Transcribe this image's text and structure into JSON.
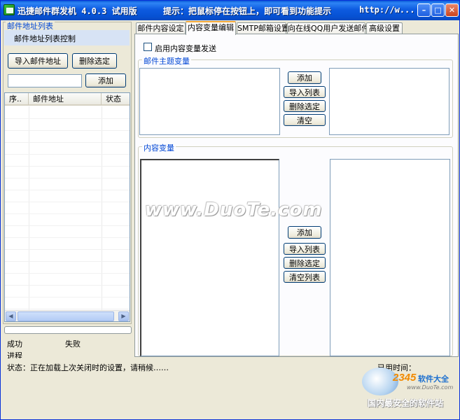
{
  "window": {
    "title": "迅捷邮件群发机 4.0.3 试用版",
    "tip": "提示：把鼠标停在按钮上，即可看到功能提示",
    "url": "http://w..."
  },
  "left": {
    "group_title": "邮件地址列表",
    "list_control_label": "邮件地址列表控制",
    "import_button": "导入邮件地址",
    "delete_button": "删除选定",
    "add_input_value": "",
    "add_button": "添加",
    "table": {
      "columns": [
        "序..",
        "邮件地址",
        "状态"
      ],
      "rows": []
    },
    "success_label": "成功",
    "fail_label": "失败",
    "progress_label": "进程",
    "progress": 0
  },
  "tabs": [
    {
      "label": "邮件内容设定",
      "active": false
    },
    {
      "label": "内容变量编辑",
      "active": true
    },
    {
      "label": "SMTP邮箱设置",
      "active": false
    },
    {
      "label": "向在线QQ用户发送邮件",
      "active": false
    },
    {
      "label": "高级设置",
      "active": false
    }
  ],
  "content": {
    "enable_checkbox_label": "启用内容变量发送",
    "enable_checked": false,
    "subject_group_title": "邮件主题变量",
    "subject_buttons": {
      "add": "添加",
      "import": "导入列表",
      "delete": "删除选定",
      "clear": "清空"
    },
    "body_group_title": "内容变量",
    "body_buttons": {
      "add": "添加",
      "import": "导入列表",
      "delete": "删除选定",
      "clear": "清空列表"
    }
  },
  "status": {
    "message": "状态：正在加载上次关闭时的设置，请稍候……",
    "elapsed_label": "已用时间："
  },
  "watermarks": {
    "duote": "www.DuoTe.com",
    "logo_number": "2345",
    "logo_text": "软件大全",
    "logo_url": "www.DuoTe.com",
    "logo_slogan": "国内最安全的软件站"
  }
}
